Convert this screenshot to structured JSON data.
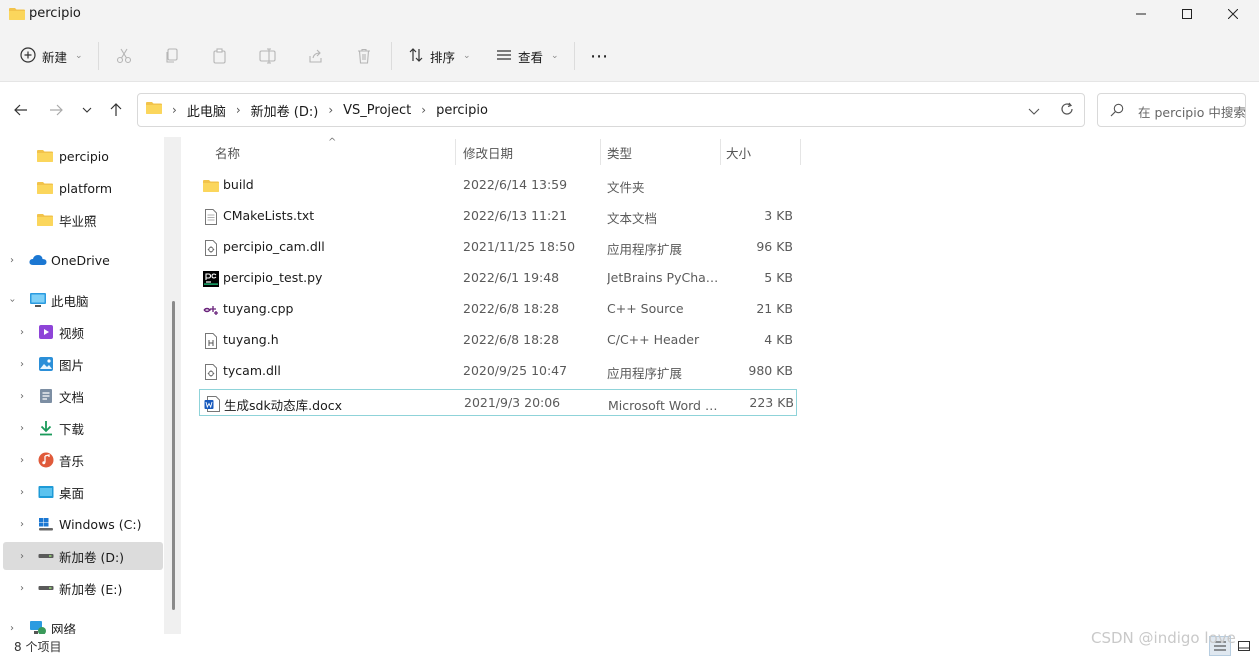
{
  "window": {
    "title": "percipio"
  },
  "toolbar": {
    "new_label": "新建",
    "sort_label": "排序",
    "view_label": "查看",
    "more_label": "⋯"
  },
  "address": {
    "crumbs": [
      "此电脑",
      "新加卷 (D:)",
      "VS_Project",
      "percipio"
    ]
  },
  "search": {
    "placeholder": "在 percipio 中搜索"
  },
  "nav": {
    "items": [
      {
        "label": "percipio",
        "icon": "folder-icon"
      },
      {
        "label": "platform",
        "icon": "folder-icon"
      },
      {
        "label": "毕业照",
        "icon": "folder-icon"
      },
      {
        "label": "OneDrive",
        "icon": "cloud-icon"
      },
      {
        "label": "此电脑",
        "icon": "computer-icon"
      },
      {
        "label": "视频",
        "icon": "video-icon"
      },
      {
        "label": "图片",
        "icon": "picture-icon"
      },
      {
        "label": "文档",
        "icon": "document-icon"
      },
      {
        "label": "下载",
        "icon": "download-icon"
      },
      {
        "label": "音乐",
        "icon": "music-icon"
      },
      {
        "label": "桌面",
        "icon": "desktop-icon"
      },
      {
        "label": "Windows (C:)",
        "icon": "windows-drive-icon"
      },
      {
        "label": "新加卷 (D:)",
        "icon": "drive-icon"
      },
      {
        "label": "新加卷 (E:)",
        "icon": "drive-icon"
      },
      {
        "label": "网络",
        "icon": "network-icon"
      }
    ]
  },
  "columns": {
    "name": "名称",
    "date": "修改日期",
    "type": "类型",
    "size": "大小"
  },
  "files": [
    {
      "name": "build",
      "date": "2022/6/14 13:59",
      "type": "文件夹",
      "size": "",
      "icon": "folder-icon"
    },
    {
      "name": "CMakeLists.txt",
      "date": "2022/6/13 11:21",
      "type": "文本文档",
      "size": "3 KB",
      "icon": "text-file-icon"
    },
    {
      "name": "percipio_cam.dll",
      "date": "2021/11/25 18:50",
      "type": "应用程序扩展",
      "size": "96 KB",
      "icon": "dll-file-icon"
    },
    {
      "name": "percipio_test.py",
      "date": "2022/6/1 19:48",
      "type": "JetBrains PyCharm",
      "size": "5 KB",
      "icon": "pycharm-file-icon"
    },
    {
      "name": "tuyang.cpp",
      "date": "2022/6/8 18:28",
      "type": "C++ Source",
      "size": "21 KB",
      "icon": "cpp-file-icon"
    },
    {
      "name": "tuyang.h",
      "date": "2022/6/8 18:28",
      "type": "C/C++ Header",
      "size": "4 KB",
      "icon": "header-file-icon"
    },
    {
      "name": "tycam.dll",
      "date": "2020/9/25 10:47",
      "type": "应用程序扩展",
      "size": "980 KB",
      "icon": "dll-file-icon"
    },
    {
      "name": "生成sdk动态库.docx",
      "date": "2021/9/3 20:06",
      "type": "Microsoft Word 文档",
      "size": "223 KB",
      "icon": "word-file-icon"
    }
  ],
  "status": {
    "count": "8 个项目"
  },
  "watermark": "CSDN @indigo love"
}
